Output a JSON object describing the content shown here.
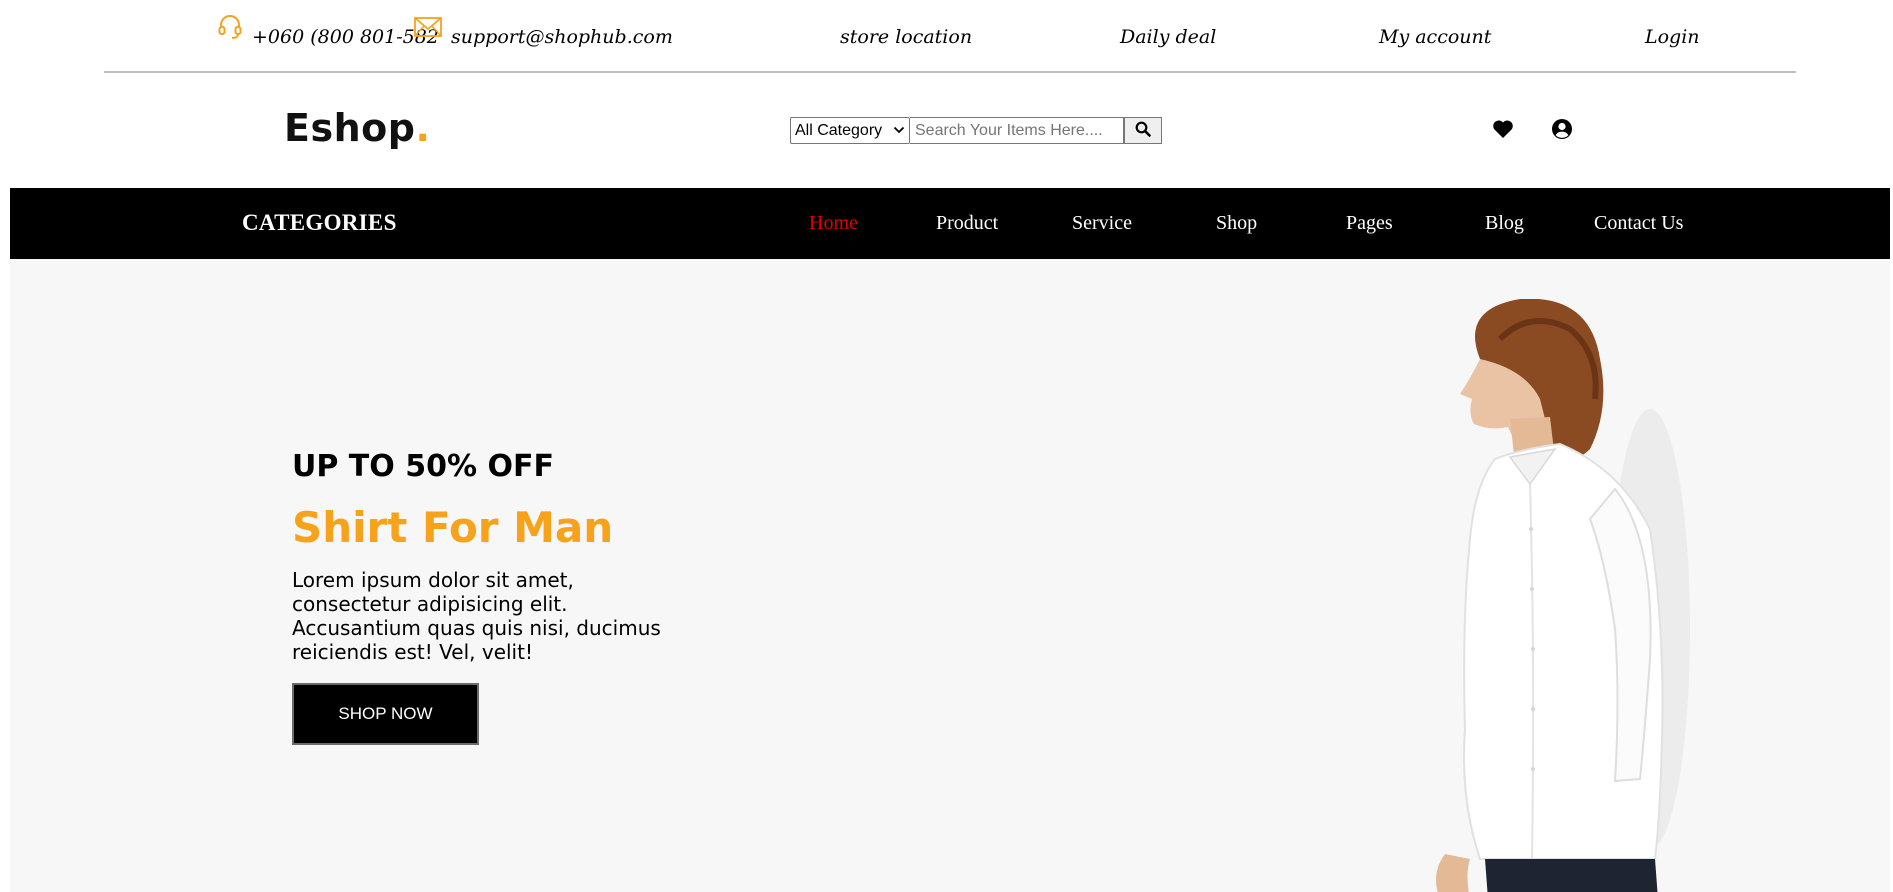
{
  "topbar": {
    "phone": "+060 (800 801-582",
    "email": "support@shophub.com",
    "links": [
      "store location",
      "Daily deal",
      "My account",
      "Login"
    ]
  },
  "header": {
    "logo_text": "Eshop",
    "logo_dot": ".",
    "category_select": "All Category",
    "search_placeholder": "Search Your Items Here....",
    "icons": [
      "heart-icon",
      "user-circle-icon",
      "search-icon",
      "headset-icon",
      "envelope-icon"
    ]
  },
  "nav": {
    "categories_label": "CATEGORIES",
    "links": [
      "Home",
      "Product",
      "Service",
      "Shop",
      "Pages",
      "Blog",
      "Contact Us"
    ],
    "active": "Home"
  },
  "hero": {
    "pretitle": "UP TO 50% OFF",
    "title": "Shirt For Man",
    "text": "Lorem ipsum dolor sit amet, consectetur adipisicing elit. Accusantium quas quis nisi, ducimus reiciendis est! Vel, velit!",
    "button_label": "SHOP NOW"
  },
  "colors": {
    "accent": "#f7a21b",
    "nav_bg": "#000000",
    "nav_active": "#e00000",
    "hero_bg": "#f7f7f7"
  }
}
